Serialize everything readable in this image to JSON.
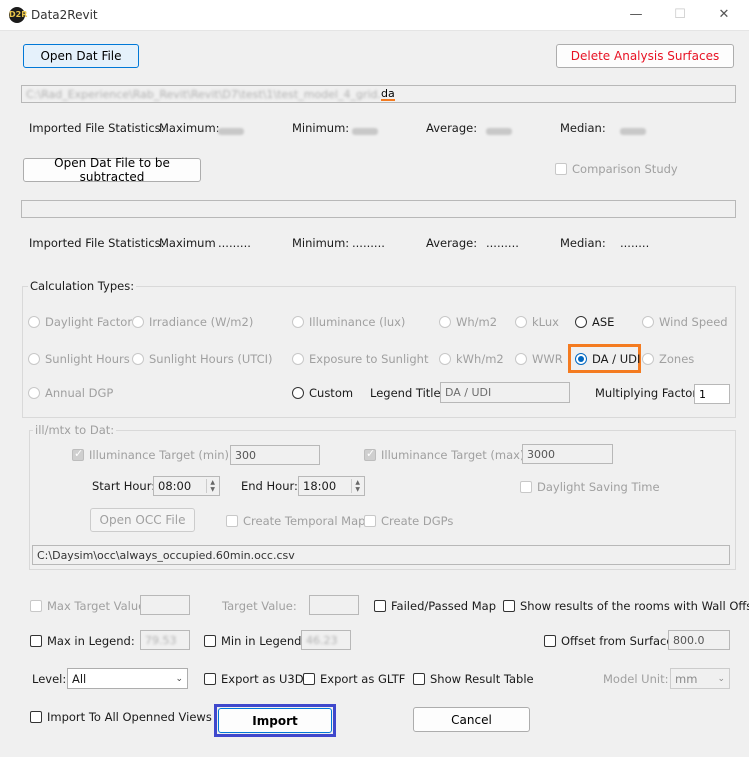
{
  "window": {
    "title": "Data2Revit",
    "logo_text": "D2R",
    "controls": {
      "minimize": "—",
      "maximize": "☐",
      "close": "✕"
    }
  },
  "top": {
    "open_dat_label": "Open Dat File",
    "delete_surfaces_label": "Delete Analysis Surfaces",
    "path_prefix_blurred": "C:\\Rad_Experience\\Rab_Revit\\Revit\\D7\\test\\1\\test_model_4_grid.",
    "path_suffix": "da"
  },
  "stats1": {
    "label": "Imported File Statistics:",
    "max_label": "Maximum:",
    "min_label": "Minimum:",
    "avg_label": "Average:",
    "median_label": "Median:"
  },
  "subtract": {
    "open_label": "Open Dat File to be subtracted",
    "comparison_label": "Comparison Study"
  },
  "stats2": {
    "label": "Imported File Statistics:",
    "max_label": "Maximum",
    "max_value": ".........",
    "min_label": "Minimum:",
    "min_value": ".........",
    "avg_label": "Average:",
    "avg_value": ".........",
    "median_label": "Median:",
    "median_value": "........"
  },
  "calc": {
    "title": "Calculation Types:",
    "options": {
      "daylight_factor": "Daylight Factor",
      "irradiance": "Irradiance (W/m2)",
      "illuminance": "Illuminance (lux)",
      "whm2": "Wh/m2",
      "klux": "kLux",
      "ase": "ASE",
      "wind_speed": "Wind Speed",
      "sunlight_hours": "Sunlight Hours",
      "sunlight_hours_utci": "Sunlight Hours (UTCI)",
      "exposure_to_sunlight": "Exposure to Sunlight",
      "kwhm2": "kWh/m2",
      "wwr": "WWR",
      "da_udi": "DA / UDI",
      "zones": "Zones",
      "annual_dgp": "Annual DGP",
      "custom": "Custom"
    },
    "legend_title_label": "Legend Title:",
    "legend_title_value": "DA / UDI",
    "multiplying_factor_label": "Multiplying Factor:",
    "multiplying_factor_value": "1"
  },
  "ill": {
    "title": "ill/mtx to Dat:",
    "target_min_label": "Illuminance Target (min):",
    "target_min_value": "300",
    "target_max_label": "Illuminance Target (max):",
    "target_max_value": "3000",
    "start_hour_label": "Start Hour:",
    "start_hour_value": "08:00",
    "end_hour_label": "End Hour:",
    "end_hour_value": "18:00",
    "dst_label": "Daylight Saving Time",
    "open_occ_label": "Open OCC File",
    "temporal_map_label": "Create Temporal Map",
    "create_dgps_label": "Create DGPs",
    "occ_path": "C:\\Daysim\\occ\\always_occupied.60min.occ.csv"
  },
  "options": {
    "max_target_label": "Max Target Value:",
    "target_value_label": "Target Value:",
    "failed_passed_label": "Failed/Passed Map",
    "wall_offset_label": "Show results of the rooms with Wall Offset",
    "max_legend_label": "Max in Legend:",
    "max_legend_value": "79.53",
    "min_legend_label": "Min in Legend:",
    "min_legend_value": "46.23",
    "offset_surface_label": "Offset from Surface:",
    "offset_surface_value": "800.0"
  },
  "bottom": {
    "level_label": "Level:",
    "level_value": "All",
    "export_u3d_label": "Export as U3D",
    "export_gltf_label": "Export as GLTF",
    "show_table_label": "Show Result Table",
    "model_unit_label": "Model Unit:",
    "model_unit_value": "mm",
    "import_all_views_label": "Import To All Openned Views",
    "import_label": "Import",
    "cancel_label": "Cancel"
  },
  "colors": {
    "highlight_orange": "#f47b20",
    "highlight_blue": "#3f48cc",
    "danger_red": "#e81123",
    "accent_blue": "#0067c0"
  }
}
